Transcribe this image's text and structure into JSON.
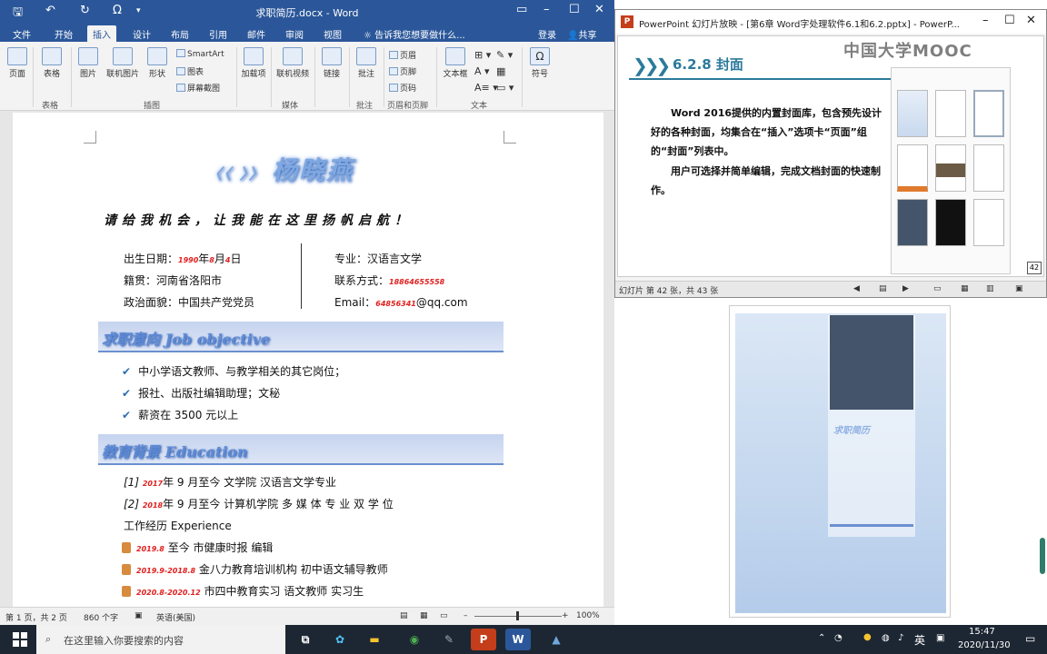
{
  "word": {
    "title": "求职简历.docx - Word",
    "tabs": [
      "文件",
      "开始",
      "插入",
      "设计",
      "布局",
      "引用",
      "邮件",
      "审阅",
      "视图"
    ],
    "active_tab": "插入",
    "tell_me": "告诉我您想要做什么...",
    "login": "登录",
    "share": "共享",
    "ribbon": {
      "page": "页面",
      "table": "表格",
      "picture": "图片",
      "online_picture": "联机图片",
      "shapes": "形状",
      "smartart": "SmartArt",
      "chart": "图表",
      "screenshot": "屏幕截图",
      "addins": "加载项",
      "online_video": "联机视频",
      "link": "链接",
      "comment": "批注",
      "header": "页眉",
      "footer": "页脚",
      "page_number": "页码",
      "textbox": "文本框",
      "symbol": "符号",
      "groups": [
        "表格",
        "插图",
        "媒体",
        "批注",
        "页眉和页脚",
        "文本"
      ]
    },
    "doc": {
      "name_art": "杨晓燕",
      "slogan": "请给我机会，让我能在这里扬帆启航！",
      "info_left": [
        {
          "label": "出生日期：",
          "y": "1990",
          "mid": "年",
          "m": "8",
          "mid2": "月",
          "d": "4",
          "end": "日"
        },
        {
          "text": "籍贯：河南省洛阳市"
        },
        {
          "text": "政治面貌：中国共产党党员"
        }
      ],
      "info_right": [
        {
          "text": "专业：汉语言文学"
        },
        {
          "label": "联系方式：",
          "val": "18864655558"
        },
        {
          "label": "Email：",
          "val": "64856341",
          "end": "@qq.com"
        }
      ],
      "section1": "求职意向 Job objective",
      "objectives": [
        "中小学语文教师、与教学相关的其它岗位；",
        "报社、出版社编辑助理；文秘",
        "薪资在 3500 元以上"
      ],
      "section2": "教育背景 Education",
      "edu": [
        {
          "idx": "[1]",
          "year": "2017",
          "rest": "年 9 月至今  文学院  汉语言文学专业"
        },
        {
          "idx": "[2]",
          "year": "2018",
          "rest": "年 9 月至今  计算机学院  多 媒 体 专 业 双 学 位"
        }
      ],
      "work_title": "工作经历 Experience",
      "work": [
        {
          "date": "2019.8",
          "text": "至今  市健康时报  编辑"
        },
        {
          "date": "2019.9-2018.8",
          "text": "金八力教育培训机构  初中语文辅导教师"
        },
        {
          "date": "2020.8-2020.12",
          "text": "市四中教育实习  语文教师  实习生"
        }
      ]
    },
    "status": {
      "page": "第 1 页，共 2 页",
      "words": "860 个字",
      "lang": "英语(美国)",
      "zoom": "100%"
    }
  },
  "ppt": {
    "title": "PowerPoint 幻灯片放映 - [第6章 Word字处理软件6.1和6.2.pptx] - PowerP...",
    "slide": {
      "watermark": "中国大学MOOC",
      "heading": "6.2.8  封面",
      "para1": "Word 2016提供的内置封面库，包含预先设计好的各种封面，均集合在“插入”选项卡“页面”组的“封面”列表中。",
      "para2": "用户可选择并简单编辑，完成文档封面的快速制作。",
      "page_no": "42"
    },
    "status": "幻灯片 第 42 张，共 43 张"
  },
  "preview": {
    "cover_title": "求职简历"
  },
  "taskbar": {
    "search_placeholder": "在这里输入你要搜索的内容",
    "ime": "英",
    "time": "15:47",
    "date": "2020/11/30"
  },
  "colors": {
    "word_blue": "#2b579a",
    "ppt_red": "#c43e1c",
    "accent_red": "#e0201f",
    "section_blue": "#5e8ad4"
  }
}
